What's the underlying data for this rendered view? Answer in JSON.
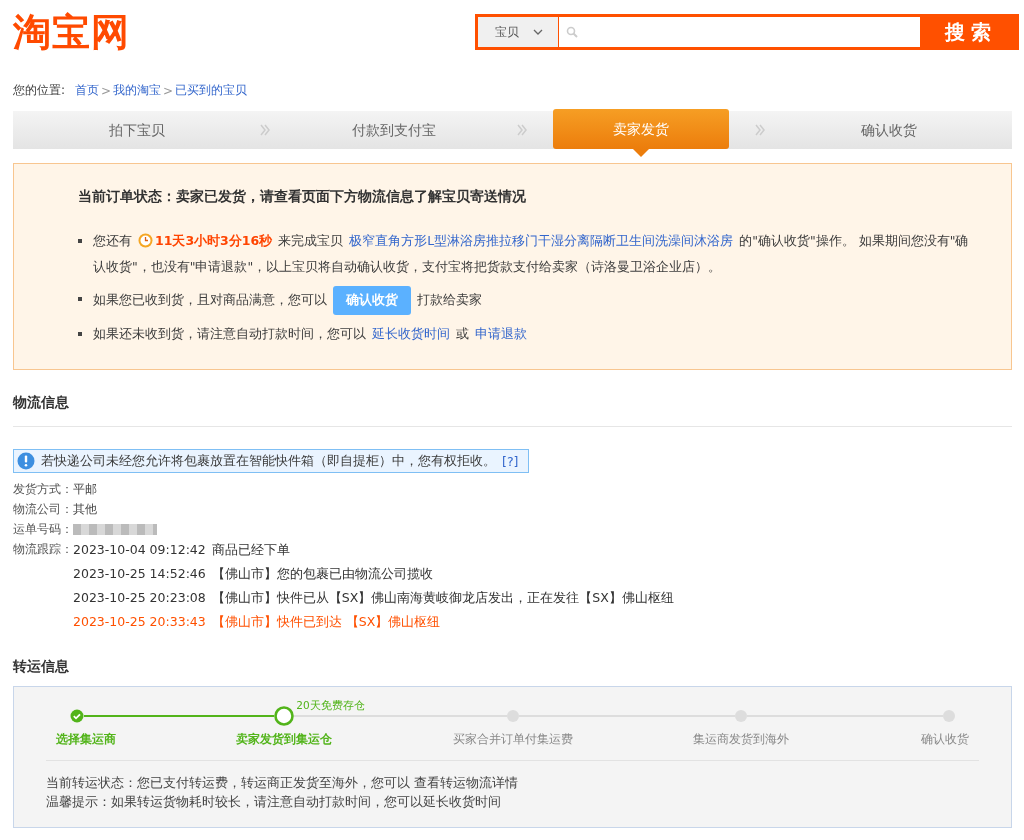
{
  "logo": "淘宝网",
  "search": {
    "category": "宝贝",
    "button": "搜 索"
  },
  "breadcrumb": {
    "label": "您的位置:",
    "separator": ">",
    "items": [
      "首页",
      "我的淘宝",
      "已买到的宝贝"
    ]
  },
  "steps": [
    {
      "label": "拍下宝贝",
      "selected": false
    },
    {
      "label": "付款到支付宝",
      "selected": false
    },
    {
      "label": "卖家发货",
      "selected": true
    },
    {
      "label": "确认收货",
      "selected": false
    }
  ],
  "order_status": {
    "title": "当前订单状态：卖家已发货，请查看页面下方物流信息了解宝贝寄送情况",
    "bullets": [
      [
        {
          "kind": "text",
          "text": "您还有"
        },
        {
          "kind": "countdown",
          "text": "11天3小时3分16秒"
        },
        {
          "kind": "text",
          "text": "来完成宝贝"
        },
        {
          "kind": "link",
          "text": "极窄直角方形L型淋浴房推拉移门干湿分离隔断卫生间洗澡间沐浴房"
        },
        {
          "kind": "text",
          "text": "的\"确认收货\"操作。 如果期间您没有\"确认收货\"，也没有\"申请退款\"，以上宝贝将自动确认收货，支付宝将把货款支付给卖家（诗洛曼卫浴企业店）。"
        }
      ],
      [
        {
          "kind": "text",
          "text": "如果您已收到货，且对商品满意，您可以"
        },
        {
          "kind": "button",
          "text": "确认收货"
        },
        {
          "kind": "text",
          "text": "打款给卖家"
        }
      ],
      [
        {
          "kind": "text",
          "text": "如果还未收到货，请注意自动打款时间，您可以"
        },
        {
          "kind": "link",
          "text": "延长收货时间"
        },
        {
          "kind": "text",
          "text": "或"
        },
        {
          "kind": "link",
          "text": "申请退款"
        }
      ]
    ]
  },
  "logistics": {
    "heading": "物流信息",
    "notice": {
      "text": "若快递公司未经您允许将包裹放置在智能快件箱（即自提柜）中，您有权拒收。",
      "help": "[?]"
    },
    "fields": [
      {
        "label": "发货方式：",
        "value": "平邮"
      },
      {
        "label": "物流公司：",
        "value": "其他"
      },
      {
        "label": "运单号码：",
        "kind": "redacted"
      }
    ],
    "tracking_label": "物流跟踪：",
    "events": [
      {
        "time": "2023-10-04 09:12:42",
        "text": "商品已经下单",
        "latest": false
      },
      {
        "time": "2023-10-25 14:52:46",
        "text": "【佛山市】您的包裹已由物流公司揽收",
        "latest": false
      },
      {
        "time": "2023-10-25 20:23:08",
        "text": "【佛山市】快件已从【SX】佛山南海黄岐御龙店发出，正在发往【SX】佛山枢纽",
        "latest": false
      },
      {
        "time": "2023-10-25 20:33:43",
        "text": "【佛山市】快件已到达 【SX】佛山枢纽",
        "latest": true
      }
    ]
  },
  "transit": {
    "heading": "转运信息",
    "steps": [
      {
        "label": "选择集运商",
        "done": true,
        "selected": false
      },
      {
        "label": "卖家发货到集运仓",
        "done": true,
        "selected": true,
        "note": "20天免费存仓"
      },
      {
        "label": "买家合并订单付集运费",
        "done": false,
        "selected": false
      },
      {
        "label": "集运商发货到海外",
        "done": false,
        "selected": false
      },
      {
        "label": "确认收货",
        "done": false,
        "selected": false
      }
    ],
    "lines": [
      "当前转运状态：您已支付转运费，转运商正发货至海外，您可以 查看转运物流详情",
      "温馨提示：如果转运货物耗时较长，请注意自动打款时间，您可以延长收货时间"
    ]
  }
}
